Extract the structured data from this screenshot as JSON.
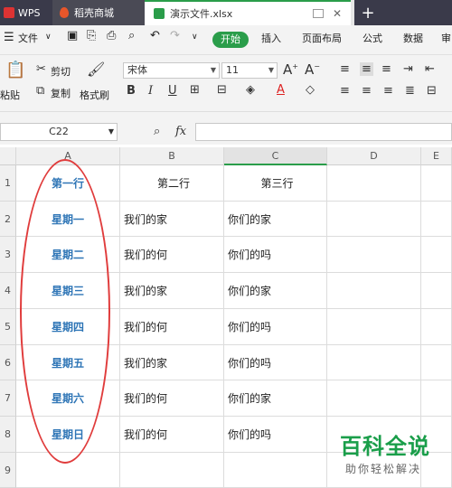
{
  "titlebar": {
    "tabs": [
      {
        "label": "WPS",
        "icon": "wps-logo-icon"
      },
      {
        "label": "稻壳商城",
        "icon": "flame-icon"
      },
      {
        "label": "演示文件.xlsx",
        "icon": "spreadsheet-icon"
      }
    ],
    "new_tab": "+"
  },
  "menubar": {
    "file": "文件",
    "items": [
      "开始",
      "插入",
      "页面布局",
      "公式",
      "数据",
      "审"
    ]
  },
  "ribbon": {
    "paste": "粘贴",
    "cut": "剪切",
    "copy": "复制",
    "format_painter": "格式刷",
    "font_name": "宋体",
    "font_size": "11",
    "bold": "B",
    "italic": "I",
    "underline": "U",
    "grow_font": "A",
    "shrink_font": "A",
    "font_color_letter": "A"
  },
  "formula": {
    "name_box": "C22",
    "fx": "fx"
  },
  "grid": {
    "columns": [
      "A",
      "B",
      "C",
      "D",
      "E"
    ],
    "selected_column": "C",
    "rows": [
      {
        "num": "1",
        "a": "第一行",
        "b": "第二行",
        "c": "第三行"
      },
      {
        "num": "2",
        "a": "星期一",
        "b": "我们的家",
        "c": "你们的家"
      },
      {
        "num": "3",
        "a": "星期二",
        "b": "我们的何",
        "c": "你们的吗"
      },
      {
        "num": "4",
        "a": "星期三",
        "b": "我们的家",
        "c": "你们的家"
      },
      {
        "num": "5",
        "a": "星期四",
        "b": "我们的何",
        "c": "你们的吗"
      },
      {
        "num": "6",
        "a": "星期五",
        "b": "我们的家",
        "c": "你们的吗"
      },
      {
        "num": "7",
        "a": "星期六",
        "b": "我们的何",
        "c": "你们的家"
      },
      {
        "num": "8",
        "a": "星期日",
        "b": "我们的何",
        "c": "你们的吗"
      },
      {
        "num": "9",
        "a": "",
        "b": "",
        "c": ""
      }
    ]
  },
  "watermark": {
    "title": "百科全说",
    "subtitle": "助你轻松解决"
  },
  "colors": {
    "accent_green": "#2a9d4a",
    "column_a_text": "#2e75b6",
    "annotation_red": "#e03c3c"
  }
}
